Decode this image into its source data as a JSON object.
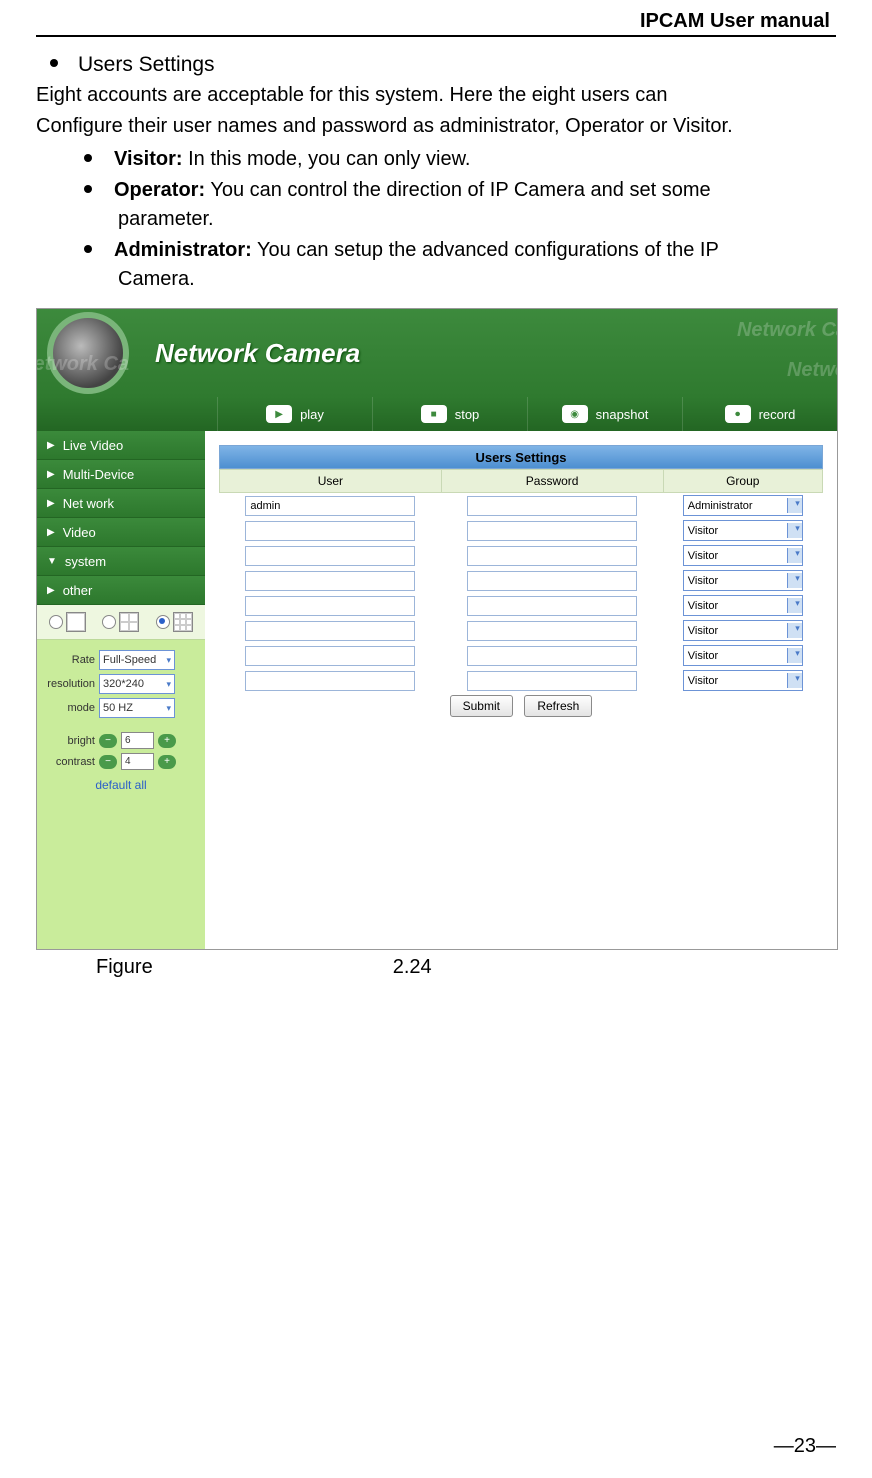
{
  "doc": {
    "header": "IPCAM User manual",
    "section_title": "Users Settings",
    "para1": "Eight accounts are acceptable for this system. Here the eight users can",
    "para2": "Configure their user names and password as administrator, Operator or Visitor.",
    "roles": [
      {
        "name": "Visitor:",
        "desc": " In this mode, you can only view."
      },
      {
        "name": "Operator:",
        "desc": " You can control the direction of IP Camera and set some",
        "cont": "parameter."
      },
      {
        "name": "Administrator:",
        "desc": " You can setup the advanced configurations of the IP",
        "cont": "Camera."
      }
    ],
    "figure_word": "Figure",
    "figure_num": "2.24",
    "page_num": "—23—"
  },
  "shot": {
    "brand": "Network Camera",
    "faded": "Network Ca",
    "toolbar": [
      "play",
      "stop",
      "snapshot",
      "record"
    ],
    "nav": [
      {
        "label": "Live Video",
        "arrow": "▶"
      },
      {
        "label": "Multi-Device",
        "arrow": "▶"
      },
      {
        "label": "Net work",
        "arrow": "▶"
      },
      {
        "label": "Video",
        "arrow": "▶"
      },
      {
        "label": "system",
        "arrow": "▼"
      },
      {
        "label": "other",
        "arrow": "▶"
      }
    ],
    "controls": {
      "rate_label": "Rate",
      "rate_value": "Full-Speed",
      "res_label": "resolution",
      "res_value": "320*240",
      "mode_label": "mode",
      "mode_value": "50 HZ",
      "bright_label": "bright",
      "bright_value": "6",
      "contrast_label": "contrast",
      "contrast_value": "4",
      "default_link": "default all"
    },
    "panel": {
      "title": "Users Settings",
      "cols": [
        "User",
        "Password",
        "Group"
      ],
      "rows": [
        {
          "user": "admin",
          "group": "Administrator"
        },
        {
          "user": "",
          "group": "Visitor"
        },
        {
          "user": "",
          "group": "Visitor"
        },
        {
          "user": "",
          "group": "Visitor"
        },
        {
          "user": "",
          "group": "Visitor"
        },
        {
          "user": "",
          "group": "Visitor"
        },
        {
          "user": "",
          "group": "Visitor"
        },
        {
          "user": "",
          "group": "Visitor"
        }
      ],
      "submit": "Submit",
      "refresh": "Refresh"
    }
  }
}
